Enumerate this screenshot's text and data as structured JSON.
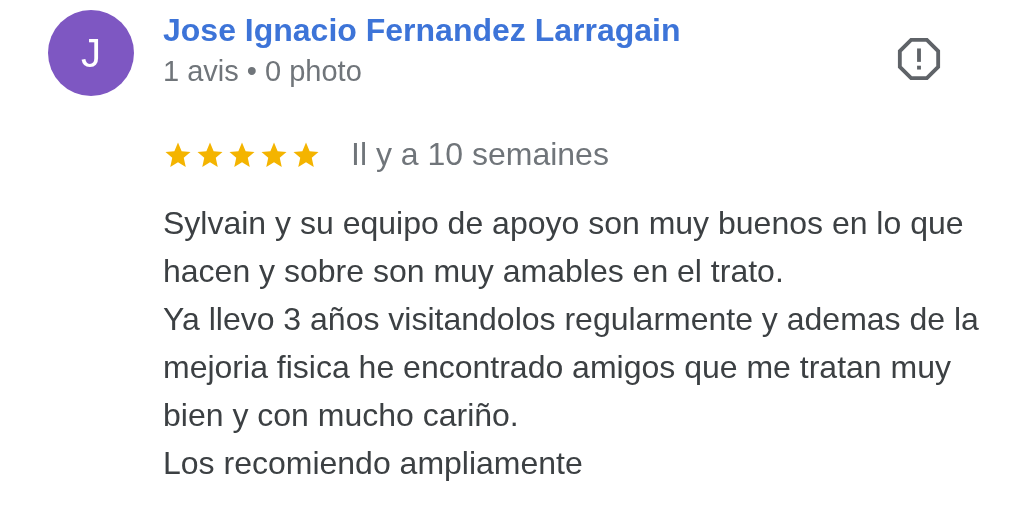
{
  "review": {
    "avatar_letter": "J",
    "author": "Jose Ignacio Fernandez Larragain",
    "meta": "1 avis • 0 photo",
    "stars": 5,
    "date": "Il y a 10 semaines",
    "paragraphs": [
      "Sylvain y su equipo de apoyo son muy buenos en lo que hacen y sobre son muy amables en el trato.",
      "Ya llevo 3 años visitandolos regularmente y ademas de la mejoria fisica he encontrado amigos que me tratan muy bien y con mucho cariño.",
      "Los recomiendo ampliamente"
    ]
  }
}
